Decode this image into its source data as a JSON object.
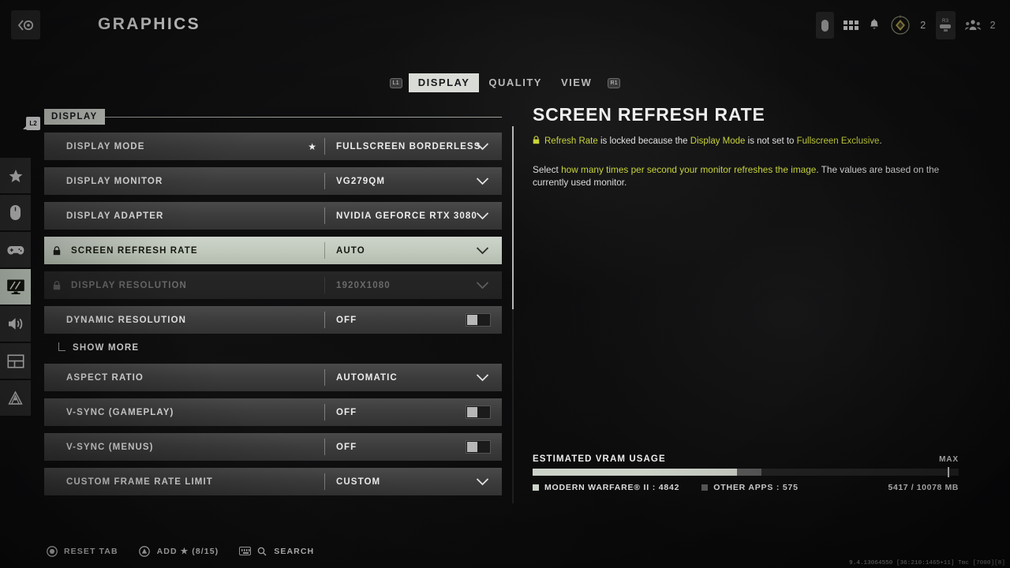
{
  "header": {
    "title": "GRAPHICS",
    "back_icon": "back-arrow-circle-icon",
    "right_icons": {
      "mic_icon": "microphone-pill-icon",
      "grid_icon": "grid-menu-icon",
      "bell_icon": "notification-bell-icon",
      "rank_icon": "rank-emblem-icon",
      "rank_count": "2",
      "r3_icon": "r3-stick-button-icon",
      "party_icon": "party-members-icon",
      "party_count": "2"
    }
  },
  "tabs": {
    "left_bumper": "L1",
    "right_bumper": "R1",
    "items": [
      {
        "label": "DISPLAY",
        "active": true
      },
      {
        "label": "QUALITY",
        "active": false
      },
      {
        "label": "VIEW",
        "active": false
      }
    ]
  },
  "rail": {
    "badge": "L2",
    "items": [
      {
        "icon": "star-icon",
        "selected": false
      },
      {
        "icon": "mouse-icon",
        "selected": false
      },
      {
        "icon": "controller-icon",
        "selected": false
      },
      {
        "icon": "monitor-graphics-icon",
        "selected": true
      },
      {
        "icon": "speaker-audio-icon",
        "selected": false
      },
      {
        "icon": "interface-layout-icon",
        "selected": false
      },
      {
        "icon": "telemetry-radar-icon",
        "selected": false
      }
    ]
  },
  "settings": {
    "section_title": "DISPLAY",
    "rows": [
      {
        "type": "dropdown",
        "label": "DISPLAY MODE",
        "value": "FULLSCREEN BORDERLESS",
        "star": true,
        "locked": false,
        "disabled": false,
        "highlighted": false
      },
      {
        "type": "dropdown",
        "label": "DISPLAY MONITOR",
        "value": "VG279QM",
        "star": false,
        "locked": false,
        "disabled": false,
        "highlighted": false
      },
      {
        "type": "dropdown",
        "label": "DISPLAY ADAPTER",
        "value": "NVIDIA GEFORCE RTX 3080",
        "star": false,
        "locked": false,
        "disabled": false,
        "highlighted": false
      },
      {
        "type": "dropdown",
        "label": "SCREEN REFRESH RATE",
        "value": "AUTO",
        "star": false,
        "locked": true,
        "disabled": false,
        "highlighted": true
      },
      {
        "type": "dropdown",
        "label": "DISPLAY RESOLUTION",
        "value": "1920X1080",
        "star": false,
        "locked": true,
        "disabled": true,
        "highlighted": false
      },
      {
        "type": "toggle",
        "label": "DYNAMIC RESOLUTION",
        "value": "OFF",
        "star": false,
        "locked": false,
        "disabled": false,
        "highlighted": false
      },
      {
        "type": "showmore",
        "label": "SHOW MORE"
      },
      {
        "type": "dropdown",
        "label": "ASPECT RATIO",
        "value": "AUTOMATIC",
        "star": false,
        "locked": false,
        "disabled": false,
        "highlighted": false
      },
      {
        "type": "toggle",
        "label": "V-SYNC (GAMEPLAY)",
        "value": "OFF",
        "star": false,
        "locked": false,
        "disabled": false,
        "highlighted": false
      },
      {
        "type": "toggle",
        "label": "V-SYNC (MENUS)",
        "value": "OFF",
        "star": false,
        "locked": false,
        "disabled": false,
        "highlighted": false
      },
      {
        "type": "dropdown",
        "label": "CUSTOM FRAME RATE LIMIT",
        "value": "CUSTOM",
        "star": false,
        "locked": false,
        "disabled": false,
        "highlighted": false
      }
    ]
  },
  "info": {
    "title": "SCREEN REFRESH RATE",
    "lock_icon": "lock-icon",
    "lock_note": {
      "part1": "Refresh Rate",
      "part2": " is locked because the ",
      "part3": "Display Mode",
      "part4": " is not set to ",
      "part5": "Fullscreen Exclusive",
      "part6": "."
    },
    "description": {
      "a": "Select ",
      "b": "how many times per second your monitor refreshes the image",
      "c": ". The values are based on the currently used monitor."
    }
  },
  "vram": {
    "title": "ESTIMATED VRAM USAGE",
    "max_label": "MAX",
    "game_legend": "MODERN WARFARE® II : 4842",
    "other_legend": "OTHER APPS : 575",
    "total": "5417 / 10078 MB",
    "game_mb": 4842,
    "other_mb": 575,
    "total_mb": 10078
  },
  "footer": {
    "reset_label": "RESET TAB",
    "add_label": "ADD ★ (8/15)",
    "search_label": "SEARCH",
    "reset_icon": "circle-button-icon",
    "add_icon": "triangle-button-icon",
    "keyboard_icon": "keyboard-icon",
    "search_icon": "magnifier-icon"
  },
  "debug": "9.4.13064550 [36:210:1465+11] Tmc [7000][8]",
  "colors": {
    "accent_yellow": "#c8d43a",
    "highlight": "#c3ccc0"
  }
}
